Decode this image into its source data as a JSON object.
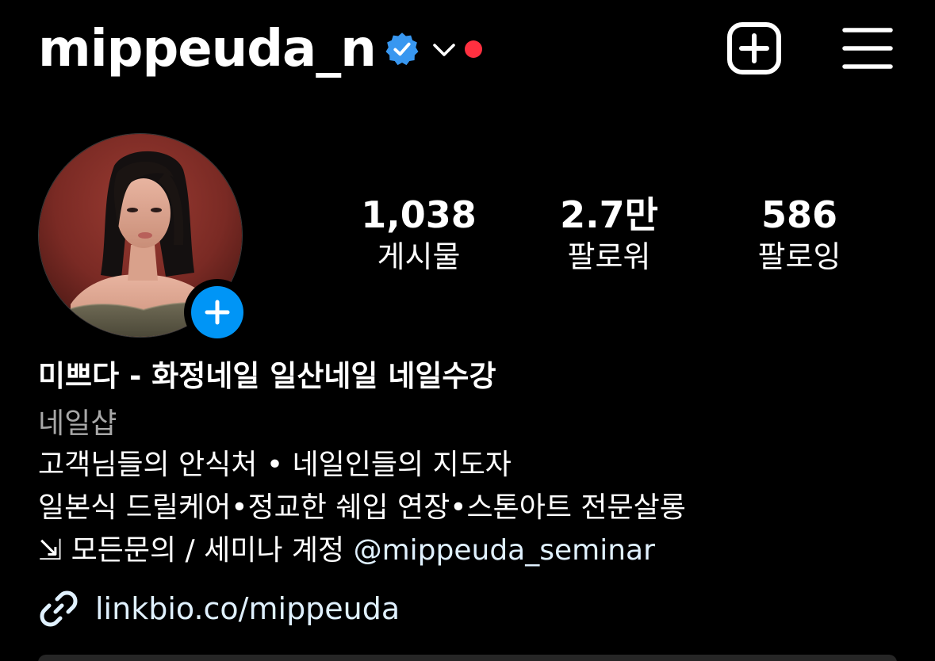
{
  "header": {
    "username": "mippeuda_n",
    "icons": {
      "verified": "verified-badge-icon",
      "account_switcher": "chevron-down-icon",
      "notification_dot": "red-dot",
      "create": "plus-square-icon",
      "menu": "hamburger-menu-icon"
    }
  },
  "profile": {
    "avatar": "profile-photo",
    "add_story_icon": "plus-icon"
  },
  "stats": {
    "posts": {
      "value": "1,038",
      "label": "게시물"
    },
    "followers": {
      "value": "2.7만",
      "label": "팔로워"
    },
    "following": {
      "value": "586",
      "label": "팔로잉"
    }
  },
  "bio": {
    "name": "미쁘다 - 화정네일 일산네일 네일수강",
    "category": "네일샵",
    "line1": "고객님들의 안식처 • 네일인들의 지도자",
    "line2": "일본식 드릴케어•정교한 쉐입 연장•스톤아트 전문살롱",
    "line3_prefix": "⇲ 모든문의 / 세미나 계정 ",
    "line3_mention": "@mippeuda_seminar",
    "link": "linkbio.co/mippeuda",
    "link_icon": "link-icon"
  },
  "colors": {
    "background": "#000000",
    "verified_blue": "#3897f0",
    "story_blue": "#0095f6",
    "notification_red": "#ff3040",
    "secondary_text": "#a8a8a8",
    "link_text": "#e0f1ff"
  }
}
